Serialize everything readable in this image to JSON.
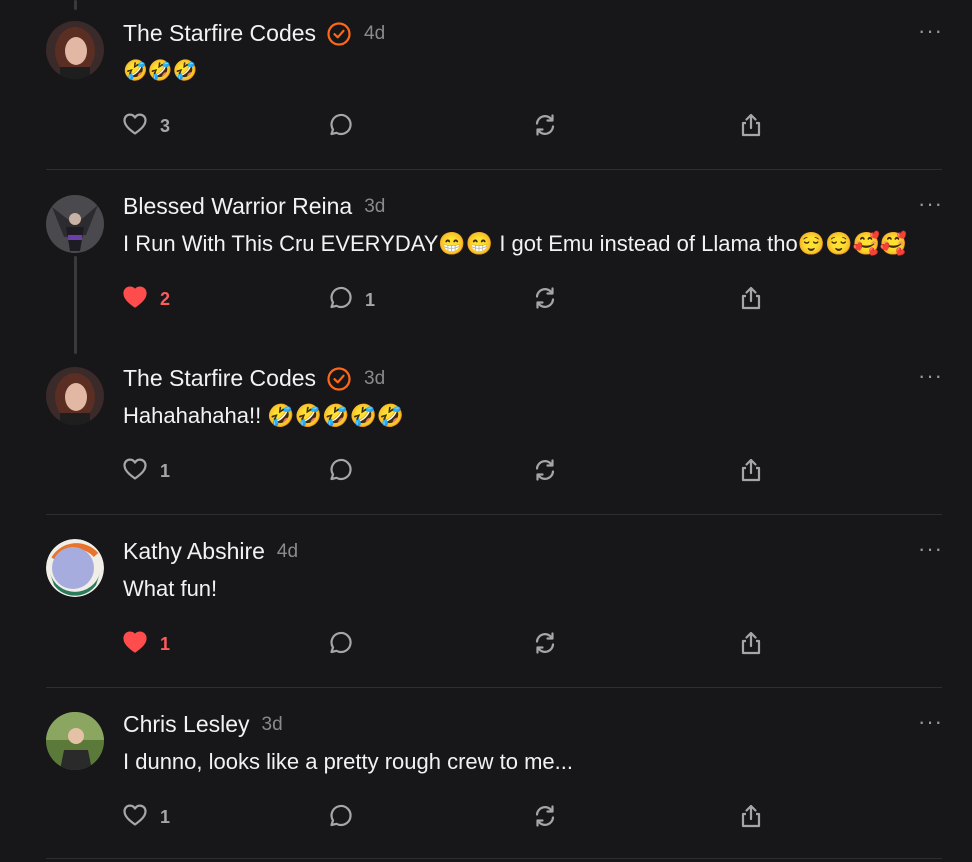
{
  "comments": [
    {
      "name": "The Starfire Codes",
      "verified": true,
      "time": "4d",
      "text": "🤣🤣🤣",
      "likes": "3",
      "liked": false,
      "replies": "",
      "avatar": "woman-portrait"
    },
    {
      "name": "Blessed Warrior Reina",
      "verified": false,
      "time": "3d",
      "text": "I Run With This Cru EVERYDAY😁😁 I got Emu instead of Llama tho😌😌🥰🥰",
      "likes": "2",
      "liked": true,
      "replies": "1",
      "avatar": "warrior-art"
    },
    {
      "name": "The Starfire Codes",
      "verified": true,
      "time": "3d",
      "text": "Hahahahaha!! 🤣🤣🤣🤣🤣",
      "likes": "1",
      "liked": false,
      "replies": "",
      "avatar": "woman-portrait"
    },
    {
      "name": "Kathy Abshire",
      "verified": false,
      "time": "4d",
      "text": "What fun!",
      "likes": "1",
      "liked": true,
      "replies": "",
      "avatar": "abstract-circle"
    },
    {
      "name": "Chris Lesley",
      "verified": false,
      "time": "3d",
      "text": "I dunno, looks like a pretty rough crew to me...",
      "likes": "1",
      "liked": false,
      "replies": "",
      "avatar": "man-portrait"
    }
  ],
  "more_label": "···",
  "icons": [
    "heart-icon",
    "comment-icon",
    "restack-icon",
    "share-icon",
    "verified-check-icon"
  ],
  "colors": {
    "background": "#171719",
    "liked": "#ff4d4d",
    "verified": "#ff6719",
    "muted": "#8a8a8e"
  }
}
